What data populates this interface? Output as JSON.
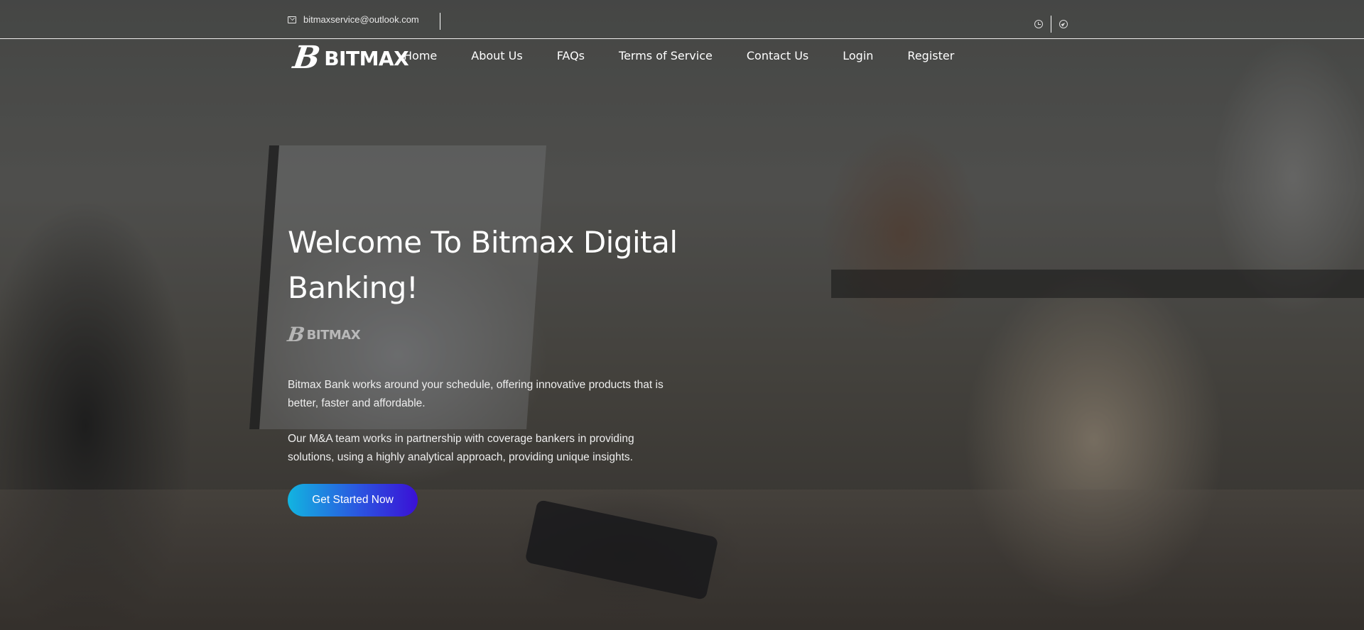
{
  "topbar": {
    "email": "bitmaxservice@outlook.com",
    "icons": [
      "clock-icon",
      "send-icon"
    ]
  },
  "brand": {
    "mark": "B",
    "name": "BITMAX"
  },
  "nav": {
    "items": [
      {
        "label": "Home"
      },
      {
        "label": "About Us"
      },
      {
        "label": "FAQs"
      },
      {
        "label": "Terms of Service"
      },
      {
        "label": "Contact Us"
      },
      {
        "label": "Login"
      },
      {
        "label": "Register"
      }
    ]
  },
  "hero": {
    "title_line1": "Welcome To Bitmax Digital",
    "title_line2": "Banking!",
    "paragraph1": "Bitmax Bank works around your schedule, offering innovative products that is better, faster and affordable.",
    "paragraph2": "Our M&A team works in partnership with coverage bankers in providing solutions, using a highly analytical approach, providing unique insights.",
    "cta_label": "Get Started Now"
  },
  "colors": {
    "cta_gradient_start": "#12b4e0",
    "cta_gradient_end": "#3a10d6"
  }
}
